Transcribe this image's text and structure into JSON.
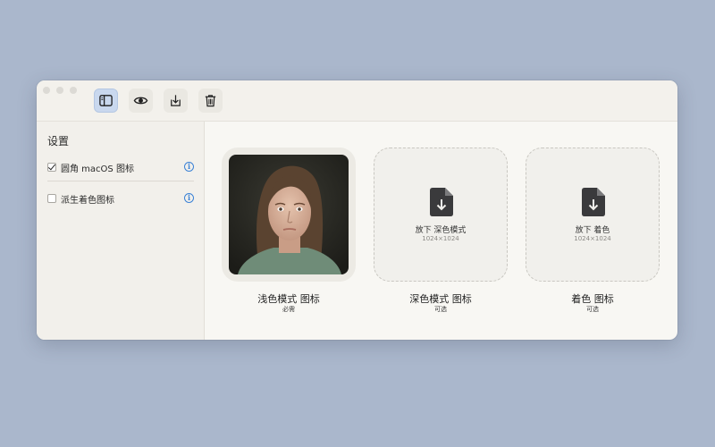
{
  "toolbar": {
    "buttons": [
      {
        "name": "sidebar-toggle",
        "icon": "sidebar-icon",
        "active": true
      },
      {
        "name": "preview",
        "icon": "eye-icon",
        "active": false
      },
      {
        "name": "export",
        "icon": "download-tray-icon",
        "active": false
      },
      {
        "name": "delete",
        "icon": "trash-icon",
        "active": false
      }
    ]
  },
  "sidebar": {
    "title": "设置",
    "options": [
      {
        "label": "圆角 macOS 图标",
        "checked": true
      },
      {
        "label": "派生着色图标",
        "checked": false
      }
    ],
    "info_symbol": "i"
  },
  "icon_slots": [
    {
      "caption": "浅色模式 图标",
      "requirement": "必需",
      "state": "filled"
    },
    {
      "caption": "深色模式 图标",
      "requirement": "可选",
      "state": "empty",
      "drop_label": "放下 深色模式",
      "size": "1024×1024"
    },
    {
      "caption": "着色 图标",
      "requirement": "可选",
      "state": "empty",
      "drop_label": "放下 着色",
      "size": "1024×1024"
    }
  ],
  "colors": {
    "background": "#aab7cc",
    "accent": "#3b82d6",
    "active_button": "#c9d8ee"
  }
}
